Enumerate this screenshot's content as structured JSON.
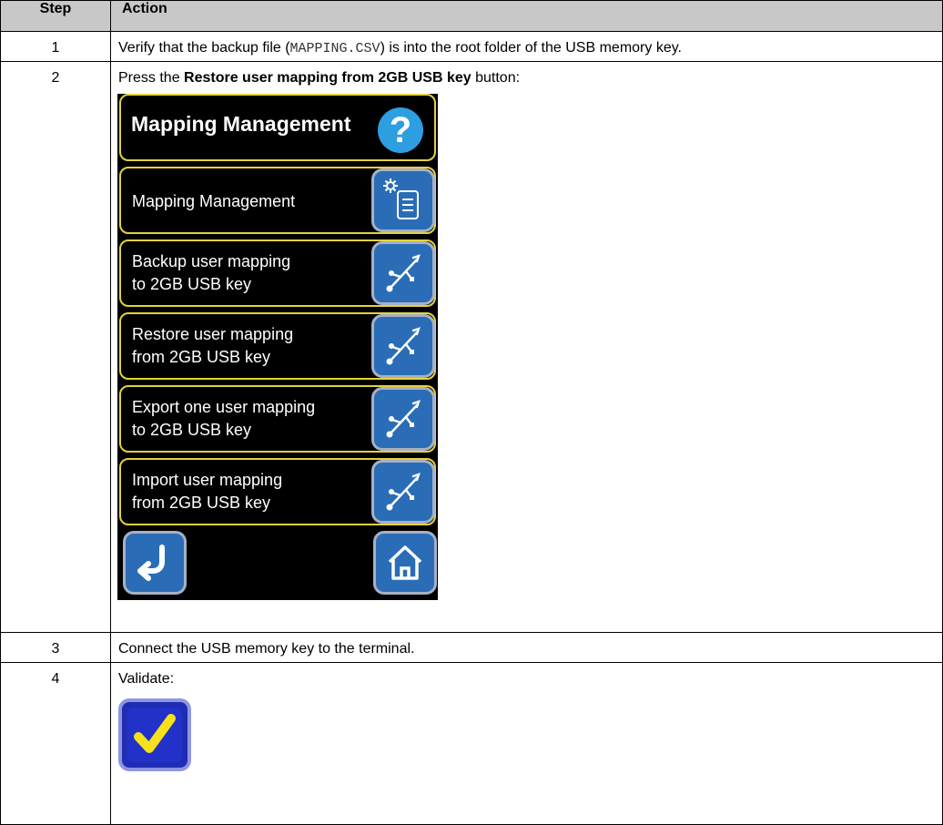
{
  "table": {
    "headers": {
      "step": "Step",
      "action": "Action"
    },
    "rows": [
      {
        "step": "1",
        "action_before": "Verify that the backup file (",
        "action_code": "MAPPING.CSV",
        "action_after": ") is into the root folder of the USB memory key."
      },
      {
        "step": "2",
        "action_before": "Press the ",
        "action_bold": "Restore user mapping from 2GB USB key",
        "action_after": " button:"
      },
      {
        "step": "3",
        "action": "Connect the USB memory key to the terminal."
      },
      {
        "step": "4",
        "action": "Validate:"
      }
    ]
  },
  "hmi": {
    "title": "Mapping Management",
    "help_icon_glyph": "?",
    "items": [
      {
        "line1": "Mapping Management",
        "line2": "",
        "icon": "settings-list-icon"
      },
      {
        "line1": "Backup user mapping",
        "line2": "to 2GB USB key",
        "icon": "usb-icon"
      },
      {
        "line1": "Restore user mapping",
        "line2": "from 2GB USB key",
        "icon": "usb-icon"
      },
      {
        "line1": "Export one user mapping",
        "line2": "to 2GB USB key",
        "icon": "usb-icon"
      },
      {
        "line1": "Import user mapping",
        "line2": "from 2GB USB key",
        "icon": "usb-icon"
      }
    ],
    "colors": {
      "background": "#000000",
      "panel_border": "#e3d23a",
      "button": "#2a6db6",
      "help": "#2d9ee0",
      "validate": "#1f2db5",
      "check": "#f7e11b"
    }
  }
}
